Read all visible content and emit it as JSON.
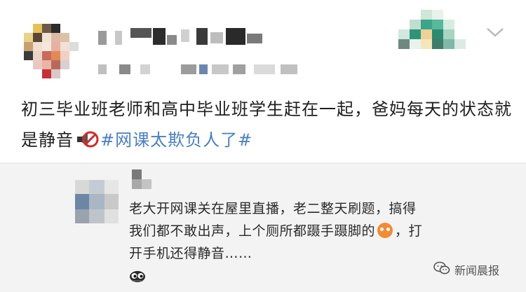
{
  "post": {
    "text_before_icon": "初三毕业班老师和高中毕业班学生赶在一起，爸妈每天的状态就是静音",
    "hashtag": "#网课太欺负人了#",
    "icons": {
      "mute": "mute-speaker-icon",
      "menu": "chevron-down-icon"
    }
  },
  "repost": {
    "text_part1": "老大开网课关在屋里直播，老二整天刷题，搞得我们都不敢出声，上个厕所都蹑手蹑脚的",
    "text_part2": "，打开手机还得静音……",
    "emojis": [
      "flushed-face-icon",
      "peeking-eyes-icon"
    ]
  },
  "watermark": {
    "text": "新闻晨报",
    "icon": "wechat-icon"
  },
  "colors": {
    "hashtag": "#4a7fbf",
    "text": "#1e1e1e",
    "repost_bg": "#f3f3f3"
  }
}
